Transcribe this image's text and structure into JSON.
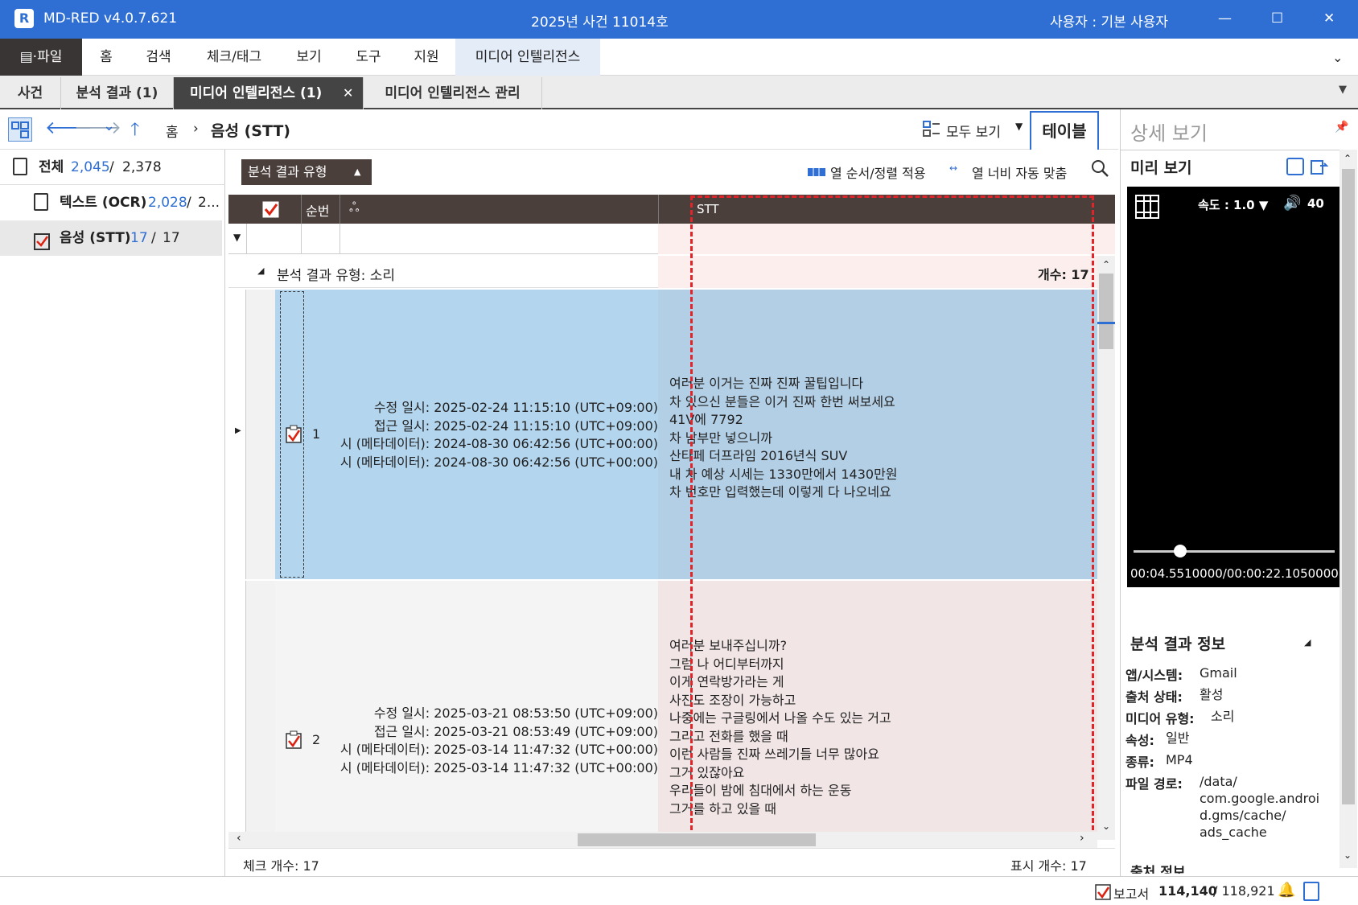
{
  "titlebar": {
    "app_name": "MD-RED v4.0.7.621",
    "case_title": "2025년 사건 11014호",
    "user_label": "사용자 :  기본 사용자",
    "minimize": "—",
    "maximize": "☐",
    "close": "✕"
  },
  "menu": {
    "file": "▤·파일",
    "items": [
      "홈",
      "검색",
      "체크/태그",
      "보기",
      "도구",
      "지원",
      "미디어 인텔리전스"
    ]
  },
  "doctabs": [
    "사건",
    "분석 결과 (1)",
    "미디어 인텔리전스 (1)",
    "미디어 인텔리전스 관리"
  ],
  "nav": {
    "home": "홈",
    "current": "음성 (STT)",
    "view_all": "모두 보기",
    "table_tab": "테이블"
  },
  "tree": {
    "all_label": "전체",
    "all_count": "2,045",
    "all_total": "2,378",
    "ocr_label": "텍스트 (OCR)",
    "ocr_count": "2,028",
    "ocr_total": "2...",
    "stt_label": "음성 (STT)",
    "stt_count": "17",
    "stt_total": "17"
  },
  "toolbar": {
    "group_button": "분석 결과 유형",
    "apply_order": "열 순서/정렬 적용",
    "auto_width": "열 너비 자동 맞춤"
  },
  "table": {
    "col_seq": "순번",
    "col_stt": "STT",
    "group_label": "분석 결과 유형: 소리",
    "group_count": "개수: 17",
    "rows": [
      {
        "seq": "1",
        "meta": "수정 일시: 2025-02-24 11:15:10 (UTC+09:00)\n접근 일시: 2025-02-24 11:15:10 (UTC+09:00)\n경 일시 (메타데이터): 2024-08-30 06:42:56 (UTC+00:00)\n장 일시 (메타데이터): 2024-08-30 06:42:56 (UTC+00:00)",
        "stt": "여러분 이거는 진짜 진짜 꿀팁입니다\n차 있으신 분들은 이거 진짜 한번 써보세요\n41V에 7792\n차 남부만 넣으니까\n산타페 더프라임 2016년식 SUV\n내 차 예상 시세는 1330만에서 1430만원\n차 번호만 입력했는데 이렇게 다 나오네요"
      },
      {
        "seq": "2",
        "meta": "수정 일시: 2025-03-21 08:53:50 (UTC+09:00)\n접근 일시: 2025-03-21 08:53:49 (UTC+09:00)\n경 일시 (메타데이터): 2025-03-14 11:47:32 (UTC+00:00)\n장 일시 (메타데이터): 2025-03-14 11:47:32 (UTC+00:00)",
        "stt": "여러분 보내주십니까?\n그럼 나 어디부터까지\n이게 연락방가라는 게\n사진도 조장이 가능하고\n나중에는 구글링에서 나올 수도 있는 거고\n그리고 전화를 했을 때\n이런 사람들 진짜 쓰레기들 너무 많아요\n그거 있잖아요\n우리들이 밤에 침대에서 하는 운동\n그거를 하고 있을 때"
      }
    ],
    "check_count": "체크 개수: 17",
    "display_count": "표시 개수: 17"
  },
  "detail": {
    "title": "상세 보기",
    "preview": "미리 보기",
    "speed": "속도 : 1.0 ▼",
    "volume": "40",
    "time": "00:04.5510000/00:00:22.1050000",
    "progress": 0.23,
    "info_title": "분석 결과 정보",
    "info": [
      {
        "k": "앱/시스템:",
        "v": "Gmail"
      },
      {
        "k": "출처 상태:",
        "v": "활성"
      },
      {
        "k": "미디어 유형:",
        "v": "소리"
      },
      {
        "k": "속성:",
        "v": "일반"
      },
      {
        "k": "종류:",
        "v": "MP4"
      },
      {
        "k": "파일 경로:",
        "v": "/data/\ncom.google.androi\nd.gms/cache/\nads_cache"
      }
    ],
    "source_info": "출처 정보"
  },
  "status": {
    "report": "보고서",
    "report_count": "114,140",
    "report_total": "/ 118,921"
  },
  "colors": {
    "title_blue": "#2f6fd4",
    "accent": "#2f6fd4",
    "selected_row": "#b3d5ee",
    "stt_bg": "#fbeeec",
    "header_dark": "#4b3f3c",
    "dash_red": "#e0242a"
  }
}
